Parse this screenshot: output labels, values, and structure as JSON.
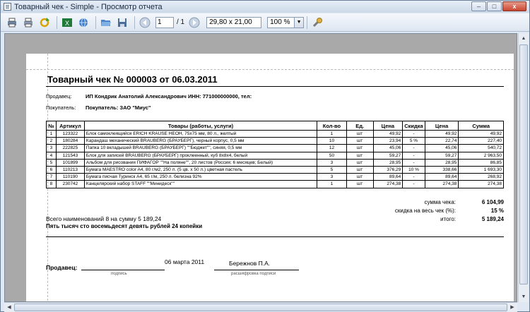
{
  "window": {
    "title": "Товарный чек - Simple - Просмотр отчета",
    "min": "–",
    "max": "□",
    "close": "x"
  },
  "toolbar": {
    "page_current": "1",
    "page_total": "/ 1",
    "page_size": "29,80 x 21,00",
    "zoom": "100 %"
  },
  "doc": {
    "title": "Товарный чек № 000003 от 06.03.2011",
    "seller_label": "Продавец:",
    "seller_value": "ИП Кондрик Анатолий Александрович  ИНН:  771000000000, тел:",
    "buyer_label": "Покупатель:",
    "buyer_value": "Покупатель: ЗАО \"Миус\""
  },
  "table": {
    "headers": [
      "№",
      "Артикул",
      "Товары (работы, услуги)",
      "Кол-во",
      "Ед.",
      "Цена",
      "Скидка",
      "Цена",
      "Сумма"
    ],
    "rows": [
      [
        "1",
        "123322",
        "Блок самоклеящийся ERICH KRAUSE НЕОН, 75х75 мм, 80 л., желтый",
        "1",
        "шт",
        "49,92",
        "-",
        "49,92",
        "49,92"
      ],
      [
        "2",
        "180284",
        "Карандаш механический BRAUBERG (БРАУБЕРГ), черный корпус, 0,5 мм",
        "10",
        "шт",
        "23,94",
        "5 %",
        "22,74",
        "227,40"
      ],
      [
        "3",
        "222825",
        "Папка 10 вкладышей BRAUBERG (БРАУБЕРГ) \"\"Бюджет\"\", синяя, 0,5 мм",
        "12",
        "шт",
        "45,06",
        "-",
        "45,06",
        "540,72"
      ],
      [
        "4",
        "121543",
        "Блок для записей BRAUBERG (БРАУБЕРГ) проклеенный, куб 8х8х4, белый",
        "50",
        "шт",
        "59,27",
        "-",
        "59,27",
        "2 963,50"
      ],
      [
        "5",
        "101899",
        "Альбом для рисования ПИФАГОР \"\"На поляне\"\", 20 листов (Россия; 6 месяцев; Белый)",
        "3",
        "шт",
        "28,95",
        "-",
        "28,95",
        "86,85"
      ],
      [
        "6",
        "110213",
        "Бумага MAESTRO color A4, 80 г/м2, 250 л. (5 цв. х 50 л.) цветная пастель",
        "5",
        "шт",
        "376,29",
        "10 %",
        "338,66",
        "1 693,30"
      ],
      [
        "7",
        "110190",
        "Бумага писчая Туринск А4, 65 г/м, 250 л. белизна 92%",
        "3",
        "шт",
        "89,64",
        "-",
        "89,64",
        "268,92"
      ],
      [
        "8",
        "230742",
        "Канцелярский набор STAFF \"\"Минидеск\"\"",
        "1",
        "шт",
        "274,38",
        "-",
        "274,38",
        "274,38"
      ]
    ]
  },
  "totals": {
    "sum_label": "сумма чека:",
    "sum_value": "6 104,99",
    "discount_label": "скидка на весь чек (%):",
    "discount_value": "15 %",
    "total_label": "итого:",
    "total_value": "5 189,24"
  },
  "summary": {
    "count_line": "Всего наименований 8 на сумму 5 189,24",
    "words_line": "Пять тысяч сто восемьдесят девять  рублей 24 копейки"
  },
  "sign": {
    "label": "Продавец:",
    "date": "06 марта 2011",
    "name": "Бережнов П.А.",
    "cap_sign": "подпись",
    "cap_decode": "расшифровка подписи"
  }
}
